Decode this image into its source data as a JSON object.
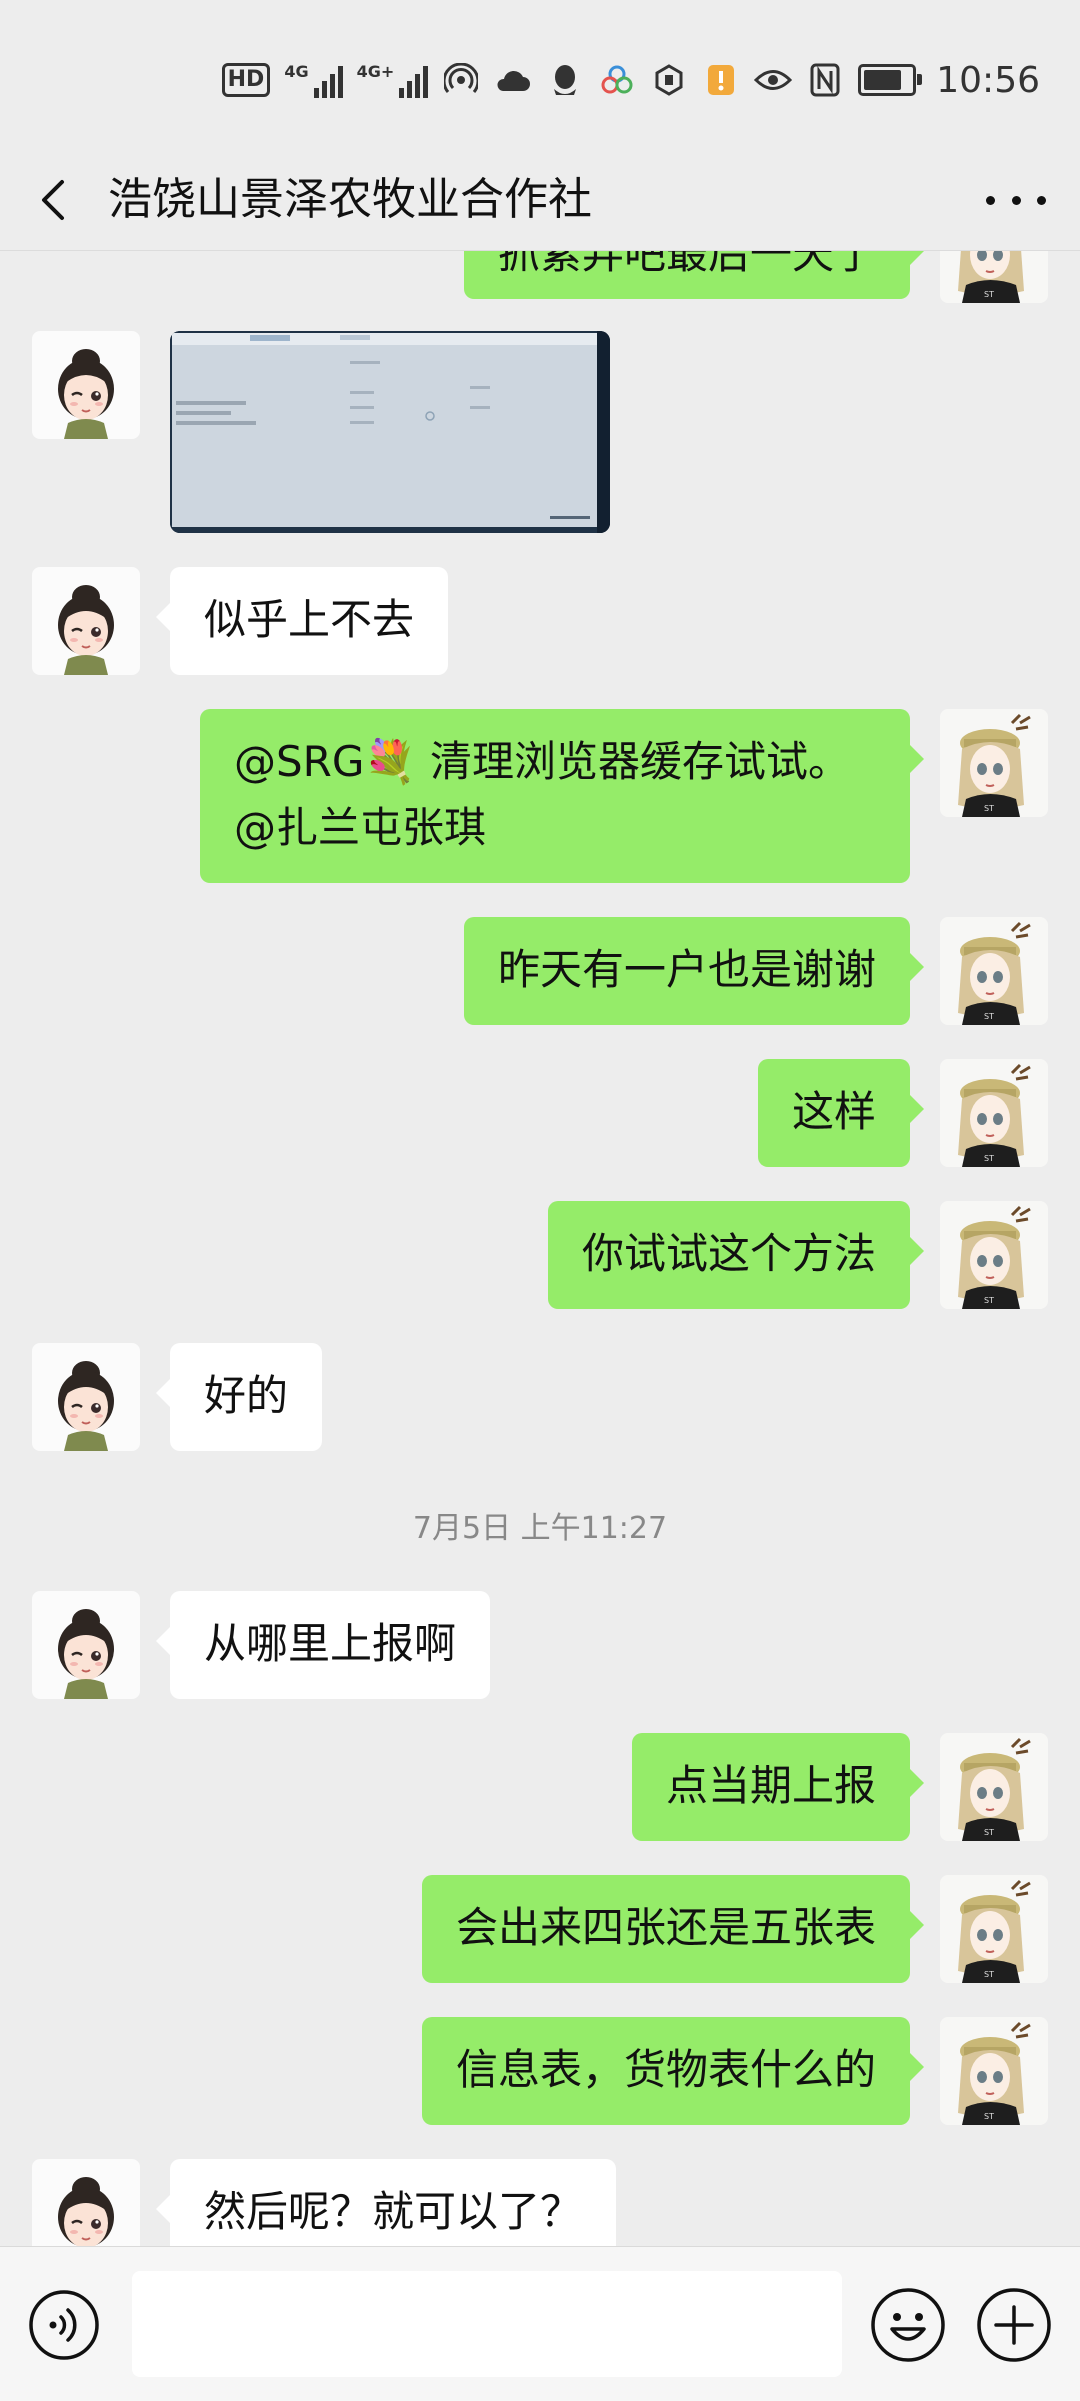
{
  "status_bar": {
    "hd": "HD",
    "sim1_net": "4G",
    "sim2_net": "4G+",
    "time": "10:56",
    "battery_level": 0.8,
    "icons": [
      "hotspot-icon",
      "cloud-icon",
      "qq-icon",
      "app-icon",
      "hexagon-icon",
      "notification-icon",
      "eye-icon",
      "nfc-icon",
      "battery-icon"
    ]
  },
  "header": {
    "title": "浩饶山景泽农牧业合作社",
    "back_icon": "chevron-left-icon",
    "more_icon": "more-dots-icon"
  },
  "messages": {
    "m0": {
      "side": "out",
      "text": "抓紧弄吧最后一天了"
    },
    "m1": {
      "side": "in",
      "type": "image"
    },
    "m2": {
      "side": "in",
      "text": "似乎上不去"
    },
    "m3": {
      "side": "out",
      "line1": "@SRG💐 清理浏览器缓存试试。",
      "line2": "@扎兰屯张琪"
    },
    "m4": {
      "side": "out",
      "text": "昨天有一户也是谢谢"
    },
    "m5": {
      "side": "out",
      "text": "这样"
    },
    "m6": {
      "side": "out",
      "text": "你试试这个方法"
    },
    "m7": {
      "side": "in",
      "text": "好的"
    },
    "timestamp": "7月5日 上午11:27",
    "m8": {
      "side": "in",
      "text": "从哪里上报啊"
    },
    "m9": {
      "side": "out",
      "text": "点当期上报"
    },
    "m10": {
      "side": "out",
      "text": "会出来四张还是五张表"
    },
    "m11": {
      "side": "out",
      "text": "信息表，货物表什么的"
    },
    "m12": {
      "side": "in",
      "text": "然后呢？就可以了？"
    }
  },
  "input_bar": {
    "voice_icon": "voice-icon",
    "input_value": "",
    "emoji_icon": "emoji-icon",
    "plus_icon": "plus-icon"
  },
  "colors": {
    "background": "#ededed",
    "outgoing_bubble": "#95ec69",
    "incoming_bubble": "#ffffff",
    "timestamp": "#888888"
  }
}
